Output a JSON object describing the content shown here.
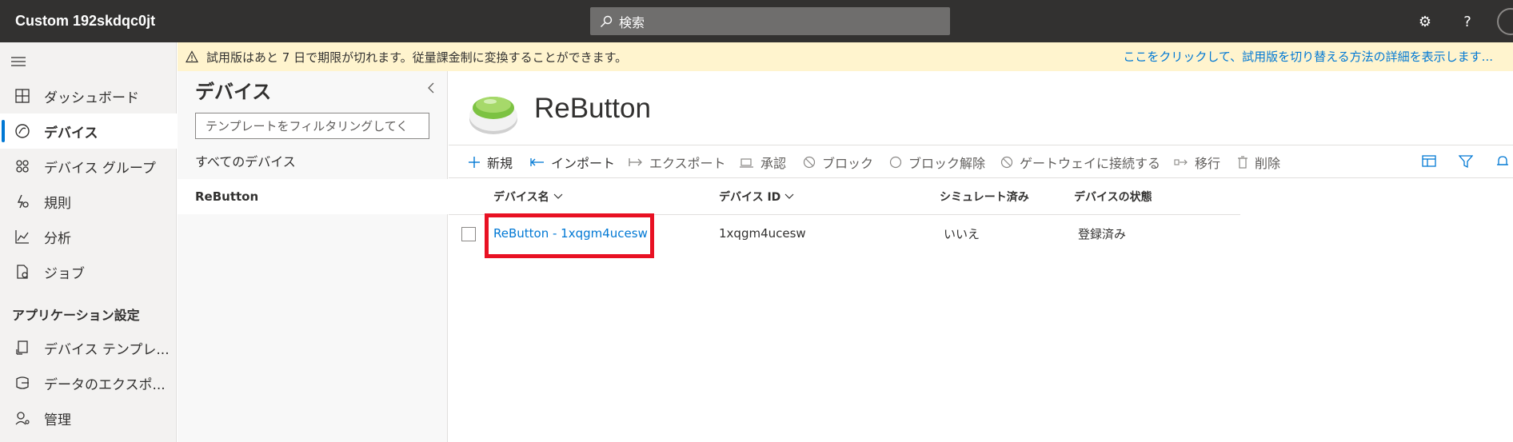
{
  "app": {
    "title": "Custom 192skdqc0jt"
  },
  "search": {
    "placeholder": "検索"
  },
  "topbar": {
    "icons": [
      "gear-icon",
      "help-icon",
      "avatar"
    ]
  },
  "nav": {
    "items": [
      {
        "label": "ダッシュボード",
        "icon": "dashboard-icon"
      },
      {
        "label": "デバイス",
        "icon": "devices-icon",
        "active": true
      },
      {
        "label": "デバイス グループ",
        "icon": "device-groups-icon"
      },
      {
        "label": "規則",
        "icon": "rules-icon"
      },
      {
        "label": "分析",
        "icon": "analytics-icon"
      },
      {
        "label": "ジョブ",
        "icon": "jobs-icon"
      }
    ],
    "section_label": "アプリケーション設定",
    "settings_items": [
      {
        "label": "デバイス テンプレ...",
        "icon": "device-templates-icon"
      },
      {
        "label": "データのエクスポ...",
        "icon": "data-export-icon"
      },
      {
        "label": "管理",
        "icon": "administration-icon"
      }
    ]
  },
  "banner": {
    "text": "試用版はあと 7 日で期限が切れます。従量課金制に変換することができます。",
    "link": "ここをクリックして、試用版を切り替える方法の詳細を表示します..."
  },
  "devices_panel": {
    "title": "デバイス",
    "filter_placeholder": "テンプレートをフィルタリングしてく",
    "items": [
      "すべてのデバイス",
      "ReButton"
    ]
  },
  "device_template": {
    "name": "ReButton"
  },
  "commands": [
    {
      "label": "新規",
      "icon": "plus-icon"
    },
    {
      "label": "インポート",
      "icon": "import-icon"
    },
    {
      "label": "エクスポート",
      "icon": "export-icon"
    },
    {
      "label": "承認",
      "icon": "approve-icon"
    },
    {
      "label": "ブロック",
      "icon": "block-icon"
    },
    {
      "label": "ブロック解除",
      "icon": "unblock-icon"
    },
    {
      "label": "ゲートウェイに接続する",
      "icon": "gateway-icon"
    },
    {
      "label": "移行",
      "icon": "migrate-icon"
    },
    {
      "label": "削除",
      "icon": "delete-icon"
    }
  ],
  "table": {
    "columns": [
      "デバイス名",
      "デバイス ID",
      "シミュレート済み",
      "デバイスの状態"
    ],
    "rows": [
      {
        "name": "ReButton - 1xqgm4ucesw",
        "id": "1xqgm4ucesw",
        "simulated": "いいえ",
        "status": "登録済み"
      }
    ]
  },
  "colors": {
    "accent": "#0078d4",
    "highlight": "#e81123",
    "banner": "#fff4ce",
    "topbar": "#323130"
  }
}
